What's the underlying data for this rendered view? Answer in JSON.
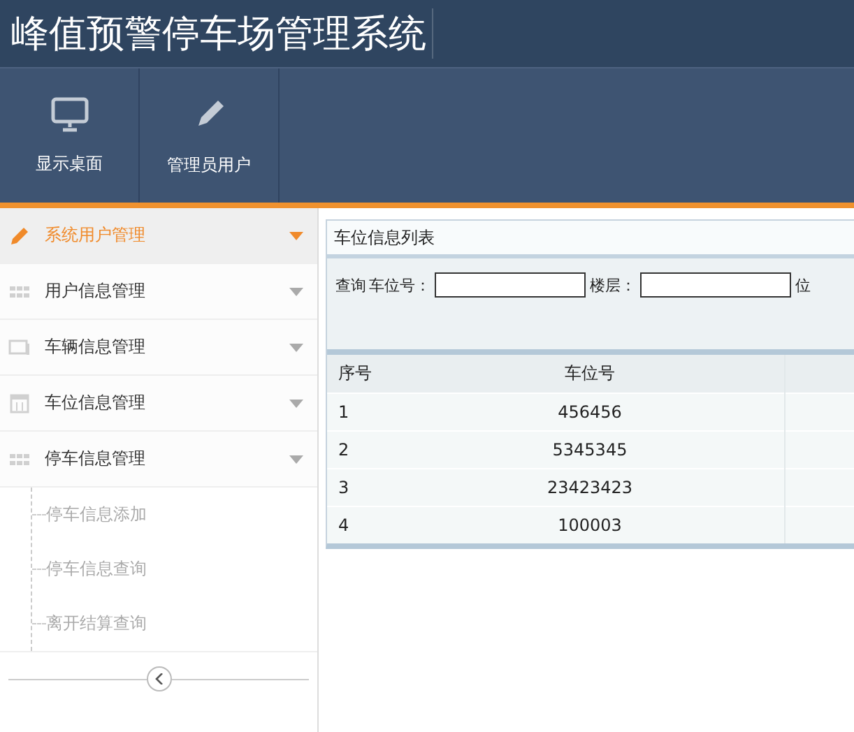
{
  "header": {
    "title": "峰值预警停车场管理系统"
  },
  "toolbar": [
    {
      "label": "显示桌面",
      "kind": "monitor"
    },
    {
      "label": "管理员用户",
      "kind": "pencil"
    }
  ],
  "sidebar": {
    "items": [
      {
        "label": "系统用户管理",
        "kind": "pencil",
        "selected": true
      },
      {
        "label": "用户信息管理",
        "kind": "grid",
        "selected": false
      },
      {
        "label": "车辆信息管理",
        "kind": "window",
        "selected": false
      },
      {
        "label": "车位信息管理",
        "kind": "calendar",
        "selected": false
      },
      {
        "label": "停车信息管理",
        "kind": "grid",
        "selected": false,
        "children": [
          {
            "label": "停车信息添加"
          },
          {
            "label": "停车信息查询"
          },
          {
            "label": "离开结算查询"
          }
        ]
      }
    ]
  },
  "panel": {
    "title": "车位信息列表",
    "query_label": "查询",
    "filters": [
      {
        "label": "车位号："
      },
      {
        "label": "楼层："
      },
      {
        "label": "位"
      }
    ],
    "table": {
      "columns": [
        "序号",
        "车位号"
      ],
      "rows": [
        [
          "1",
          "456456"
        ],
        [
          "2",
          "5345345"
        ],
        [
          "3",
          "23423423"
        ],
        [
          "4",
          "100003"
        ]
      ]
    }
  }
}
